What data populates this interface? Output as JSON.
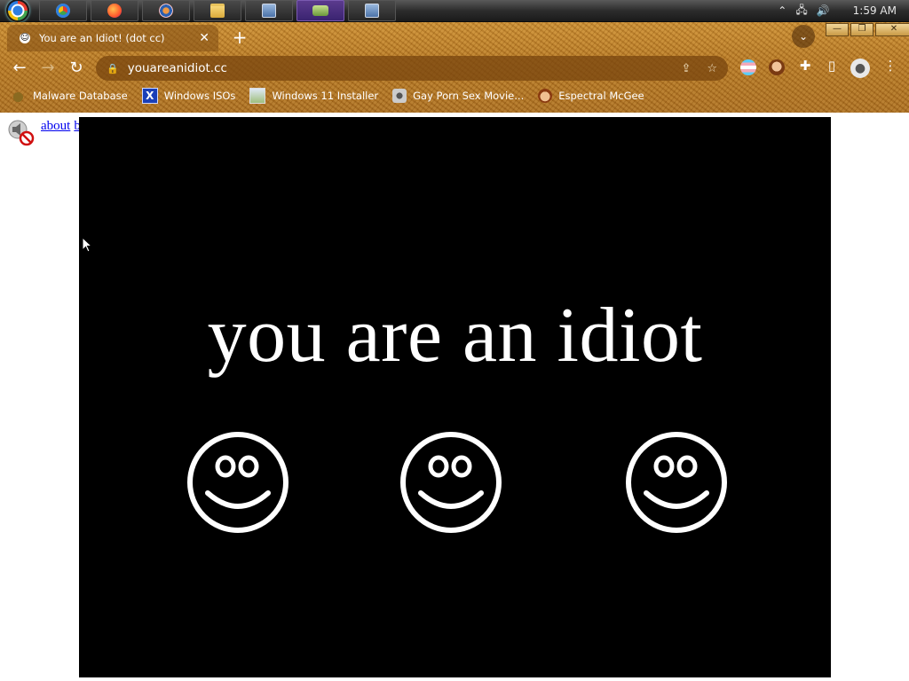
{
  "taskbar": {
    "clock": "1:59 AM"
  },
  "browser": {
    "tab_title": "You are an Idiot! (dot cc)",
    "tab_close": "✕",
    "new_tab": "+",
    "address": "youareanidiot.cc",
    "window_controls": {
      "minimize": "—",
      "restore": "❐",
      "close": "✕"
    }
  },
  "bookmarks": [
    {
      "label": "Malware Database",
      "icon": "leaf-icon"
    },
    {
      "label": "Windows ISOs",
      "icon": "x-icon"
    },
    {
      "label": "Windows 11 Installer",
      "icon": "image-icon"
    },
    {
      "label": "Gay Porn Sex Movie...",
      "icon": "camera-icon"
    },
    {
      "label": "Espectral McGee",
      "icon": "face-icon"
    }
  ],
  "page": {
    "links": {
      "about": "about",
      "back": "back"
    },
    "headline": "you are an idiot"
  },
  "colors": {
    "stage": "#000000",
    "link": "#0000ee",
    "frame_wood": "#b4741f"
  }
}
